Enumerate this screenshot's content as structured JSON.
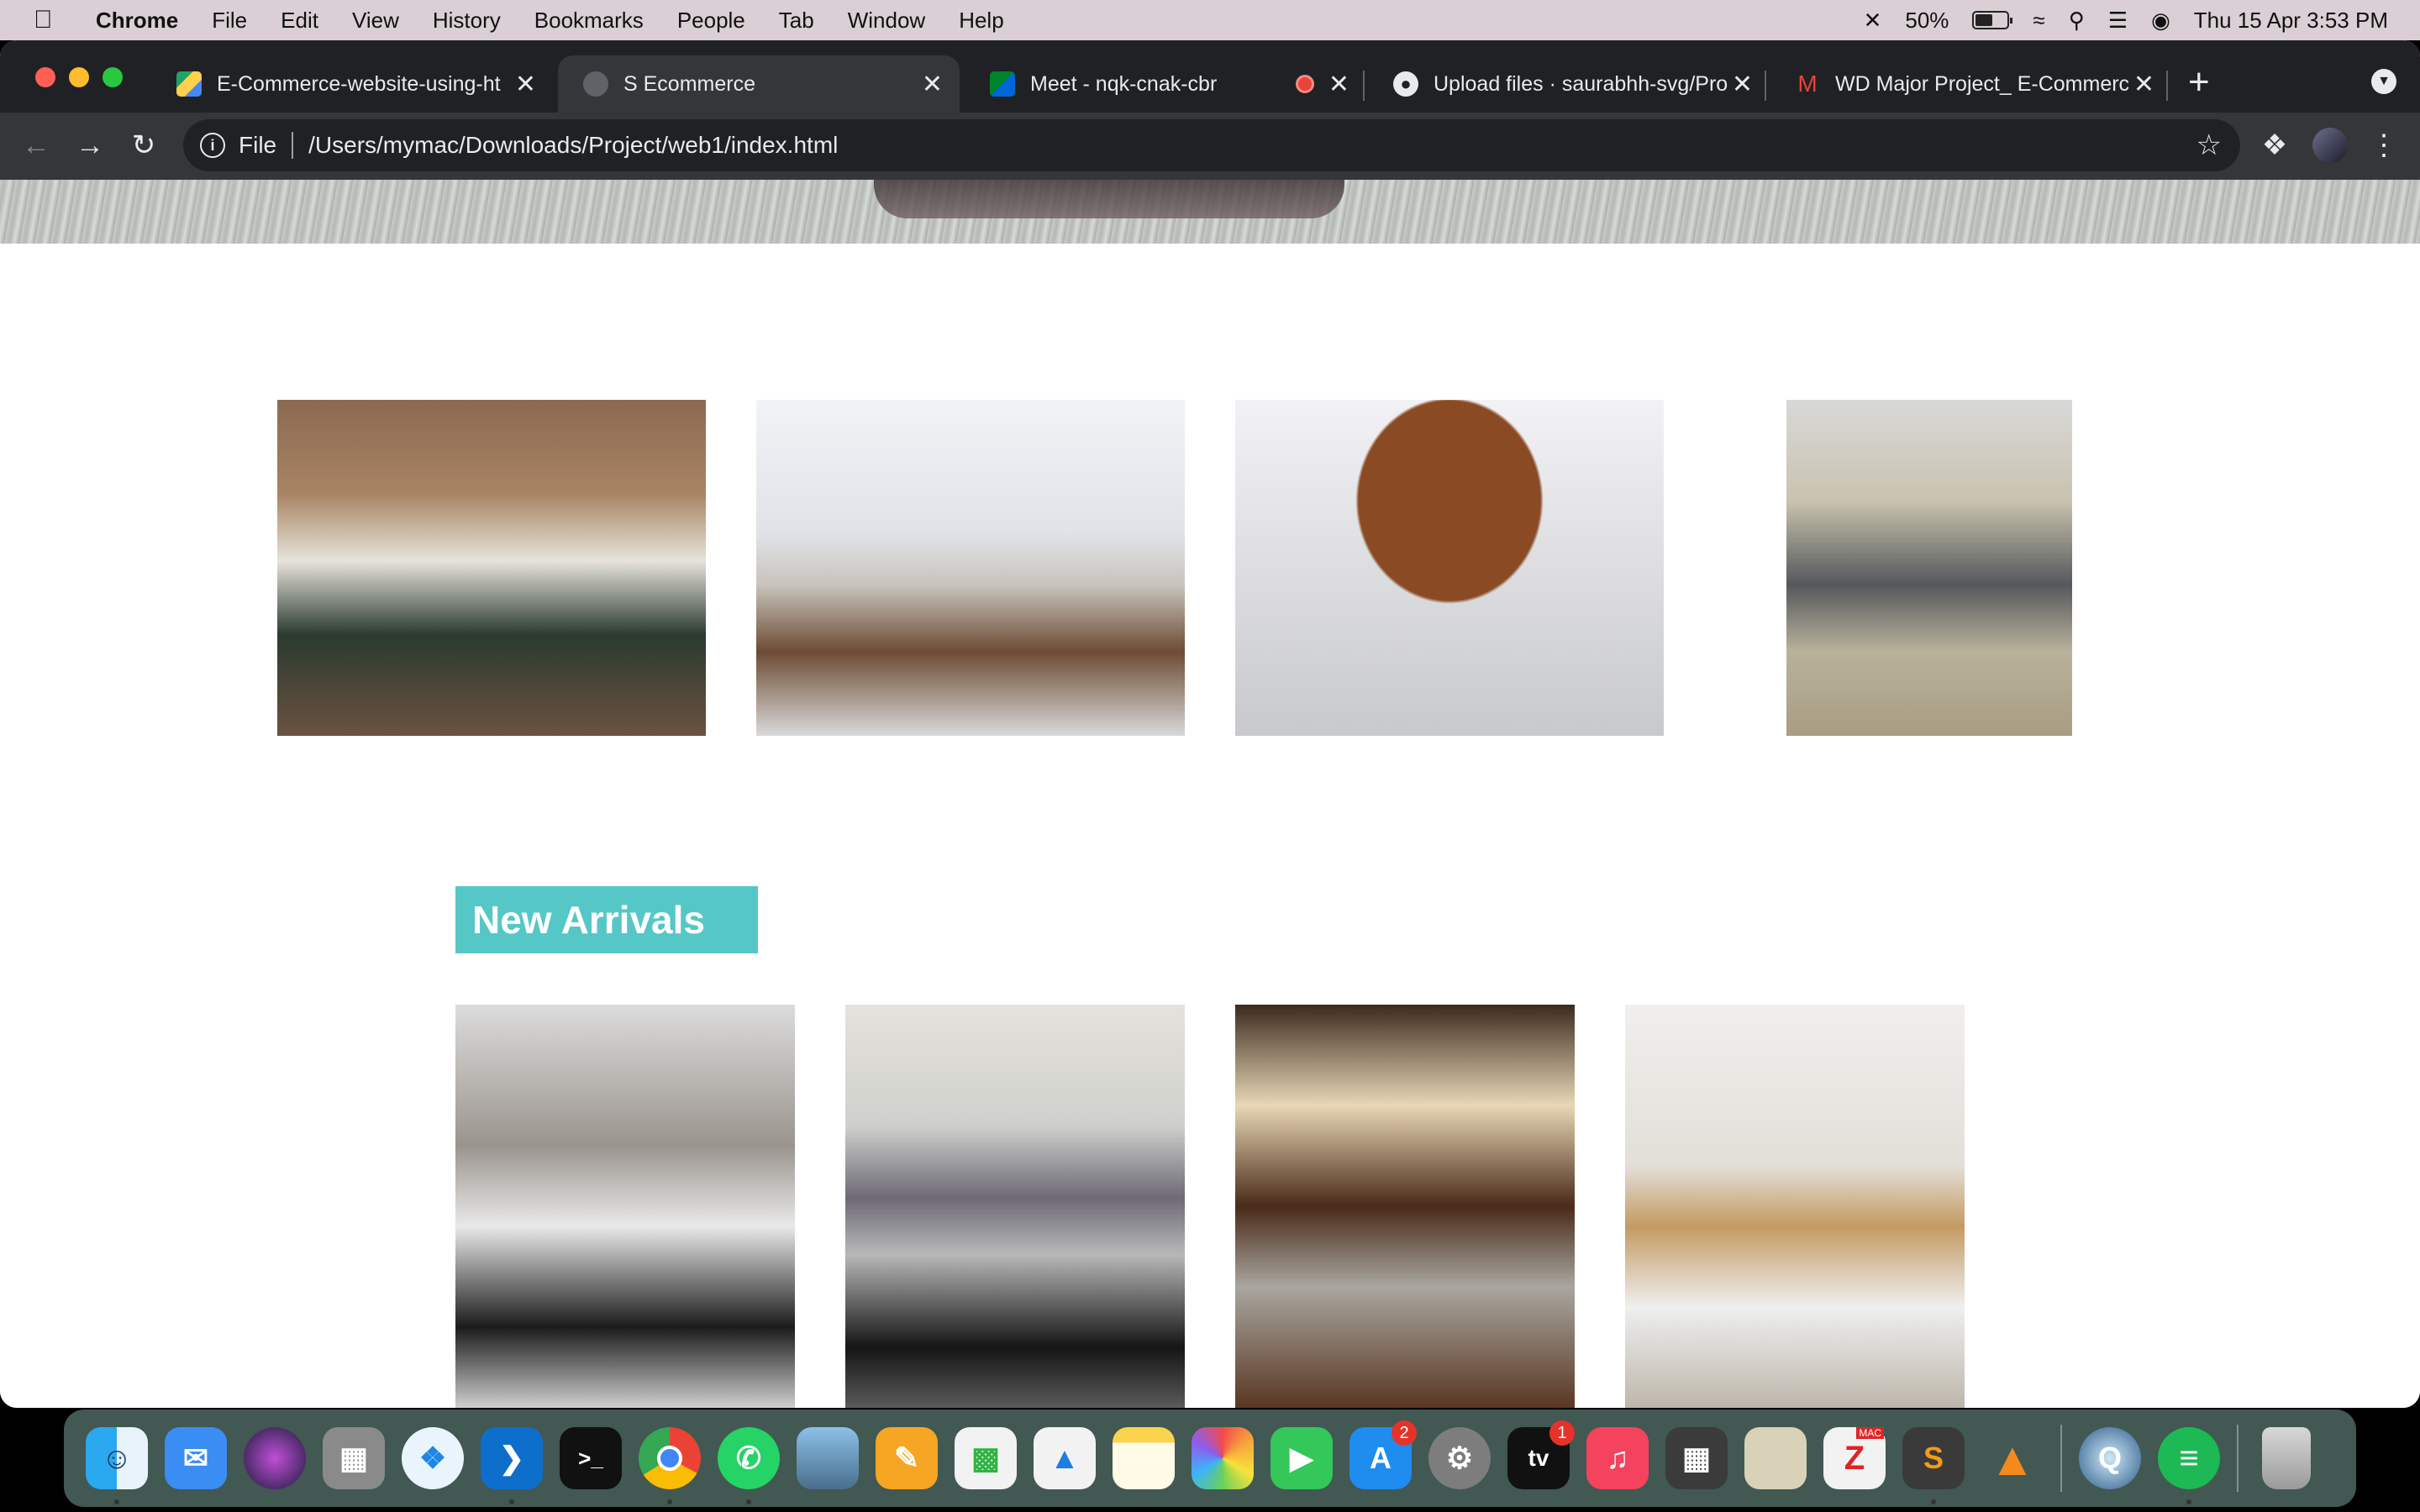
{
  "menubar": {
    "items": [
      "Chrome",
      "File",
      "Edit",
      "View",
      "History",
      "Bookmarks",
      "People",
      "Tab",
      "Window",
      "Help"
    ],
    "battery": "50%",
    "datetime": "Thu 15 Apr  3:53 PM"
  },
  "tabs": [
    {
      "title": "E-Commerce-website-using-ht",
      "icon": "google-drive-icon"
    },
    {
      "title": "S Ecommerce",
      "icon": "globe-icon"
    },
    {
      "title": "Meet - nqk-cnak-cbr",
      "icon": "google-meet-icon"
    },
    {
      "title": "Upload files · saurabhh-svg/Pro",
      "icon": "github-icon"
    },
    {
      "title": "WD Major Project_ E-Commerce",
      "icon": "gmail-icon"
    }
  ],
  "omnibox": {
    "scheme": "File",
    "url": "/Users/mymac/Downloads/Project/web1/index.html"
  },
  "page": {
    "section_title": "New Arrivals"
  },
  "dock": {
    "apps": [
      {
        "name": "finder-icon"
      },
      {
        "name": "mail-icon"
      },
      {
        "name": "siri-icon"
      },
      {
        "name": "launchpad-icon"
      },
      {
        "name": "safari-icon"
      },
      {
        "name": "vscode-icon"
      },
      {
        "name": "terminal-icon"
      },
      {
        "name": "chrome-icon"
      },
      {
        "name": "whatsapp-icon"
      },
      {
        "name": "preview-icon"
      },
      {
        "name": "pages-icon"
      },
      {
        "name": "numbers-icon"
      },
      {
        "name": "keynote-icon"
      },
      {
        "name": "notes-icon"
      },
      {
        "name": "photos-icon"
      },
      {
        "name": "facetime-icon"
      },
      {
        "name": "app-store-icon"
      },
      {
        "name": "system-preferences-icon"
      },
      {
        "name": "apple-tv-icon"
      },
      {
        "name": "music-icon"
      },
      {
        "name": "calculator-icon"
      },
      {
        "name": "file-zipper-icon"
      },
      {
        "name": "zipmac-icon"
      },
      {
        "name": "sublime-text-icon"
      },
      {
        "name": "vlc-icon"
      },
      {
        "name": "quicktime-icon"
      },
      {
        "name": "spotify-icon"
      },
      {
        "name": "trash-icon"
      }
    ],
    "badges": {
      "app_store": "2",
      "apple_tv": "1"
    },
    "tv_label": "tv",
    "mac_label": "MAC"
  },
  "colors": {
    "accent": "#56c7c7",
    "tab_active": "#35363a",
    "tab_bg": "#202124"
  }
}
